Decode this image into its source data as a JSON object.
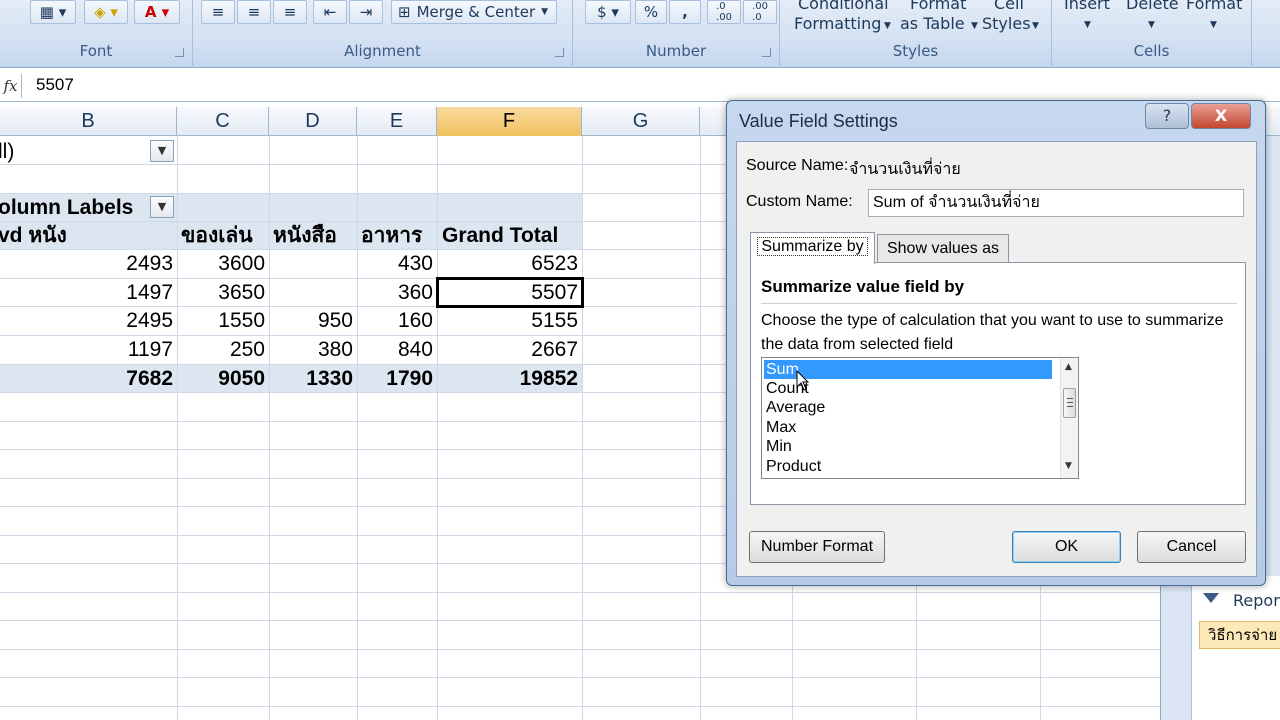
{
  "ribbon": {
    "groups": {
      "font": "Font",
      "alignment": "Alignment",
      "number": "Number",
      "styles": "Styles",
      "cells": "Cells"
    },
    "merge_center": "Merge & Center",
    "percent": "%",
    "comma": ",",
    "conditional_formatting": [
      "Conditional",
      "Formatting"
    ],
    "format_as_table": [
      "Format",
      "as Table"
    ],
    "cell_styles": [
      "Cell",
      "Styles"
    ],
    "insert": "Insert",
    "delete": "Delete",
    "format": "Format"
  },
  "formula_bar": {
    "fx": "fx",
    "value": "5507"
  },
  "columns": [
    "B",
    "C",
    "D",
    "E",
    "F",
    "G"
  ],
  "sheet": {
    "filter_value": "ll)",
    "column_labels": "olumn Labels",
    "headers": [
      "vd หนัง",
      "ของเล่น",
      "หนังสือ",
      "อาหาร",
      "Grand Total"
    ],
    "rows": [
      [
        "2493",
        "3600",
        "",
        "430",
        "6523"
      ],
      [
        "1497",
        "3650",
        "",
        "360",
        "5507"
      ],
      [
        "2495",
        "1550",
        "950",
        "160",
        "5155"
      ],
      [
        "1197",
        "250",
        "380",
        "840",
        "2667"
      ]
    ],
    "totals": [
      "7682",
      "9050",
      "1330",
      "1790",
      "19852"
    ]
  },
  "task_pane": {
    "report_filter": "Report",
    "chip": "วิธีการจ่าย"
  },
  "dialog": {
    "title": "Value Field Settings",
    "help": "?",
    "close": "X",
    "source_name_label": "Source Name:",
    "source_name_value": "จำนวนเงินที่จ่าย",
    "custom_name_label": "Custom Name:",
    "custom_name_value": "Sum of จำนวนเงินที่จ่าย",
    "tabs": [
      "Summarize by",
      "Show values as"
    ],
    "section_heading": "Summarize value field by",
    "description": "Choose the type of calculation that you want to use to summarize the data from selected field",
    "options": [
      "Sum",
      "Count",
      "Average",
      "Max",
      "Min",
      "Product"
    ],
    "selected_option": "Sum",
    "number_format_button": "Number Format",
    "ok_button": "OK",
    "cancel_button": "Cancel"
  },
  "colors": {
    "ribbon_bg": "#d5e2f2",
    "selection": "#3399ff",
    "pivot_band": "#dce6f1",
    "selected_column_header": "#f1c15f"
  }
}
